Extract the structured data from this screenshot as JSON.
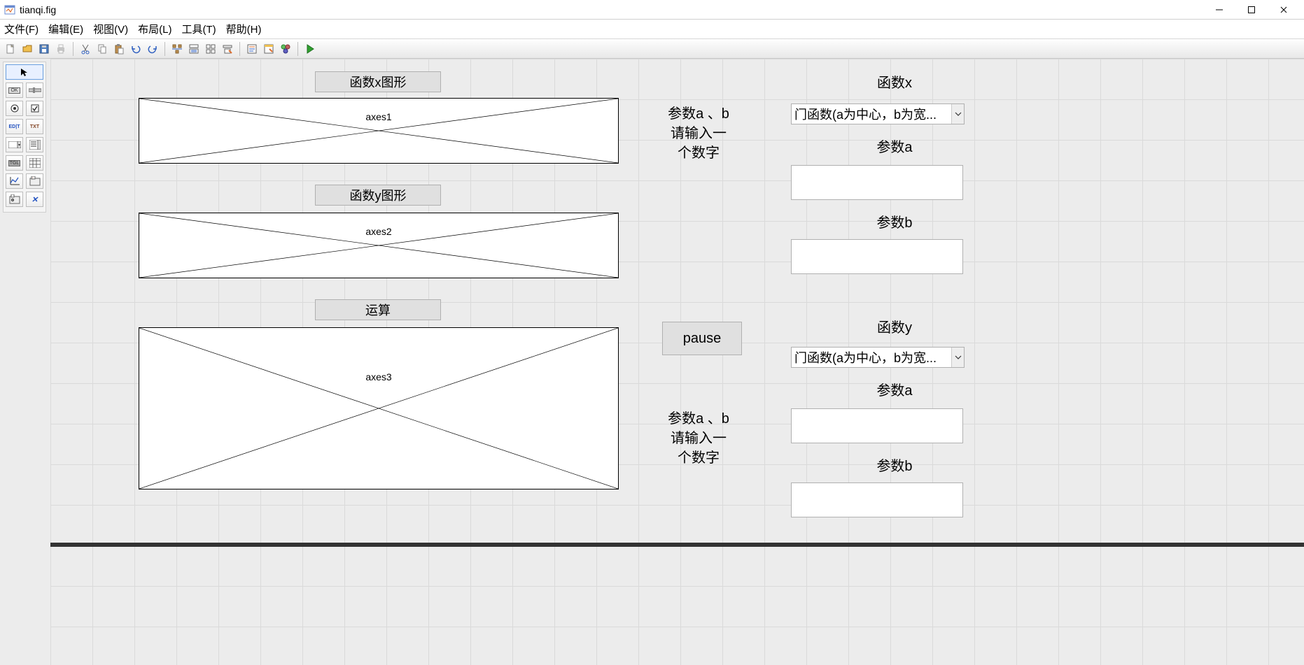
{
  "window": {
    "title": "tianqi.fig"
  },
  "menu": {
    "file": "文件(F)",
    "edit": "编辑(E)",
    "view": "视图(V)",
    "layout": "布局(L)",
    "tools": "工具(T)",
    "help": "帮助(H)"
  },
  "labels": {
    "fx_plot": "函数x图形",
    "fy_plot": "函数y图形",
    "compute": "运算",
    "fx": "函数x",
    "fy": "函数y",
    "param_a_x": "参数a",
    "param_b_x": "参数b",
    "param_a_y": "参数a",
    "param_b_y": "参数b"
  },
  "axes": {
    "a1": "axes1",
    "a2": "axes2",
    "a3": "axes3"
  },
  "text": {
    "params_hint_1": "参数a 、b\n请输入一\n个数字",
    "params_hint_2": "参数a 、b\n请输入一\n个数字"
  },
  "buttons": {
    "pause": "pause"
  },
  "dropdowns": {
    "fx_selected": "门函数(a为中心，b为宽...",
    "fy_selected": "门函数(a为中心，b为宽..."
  },
  "edits": {
    "param_a_x": "",
    "param_b_x": "",
    "param_a_y": "",
    "param_b_y": ""
  }
}
